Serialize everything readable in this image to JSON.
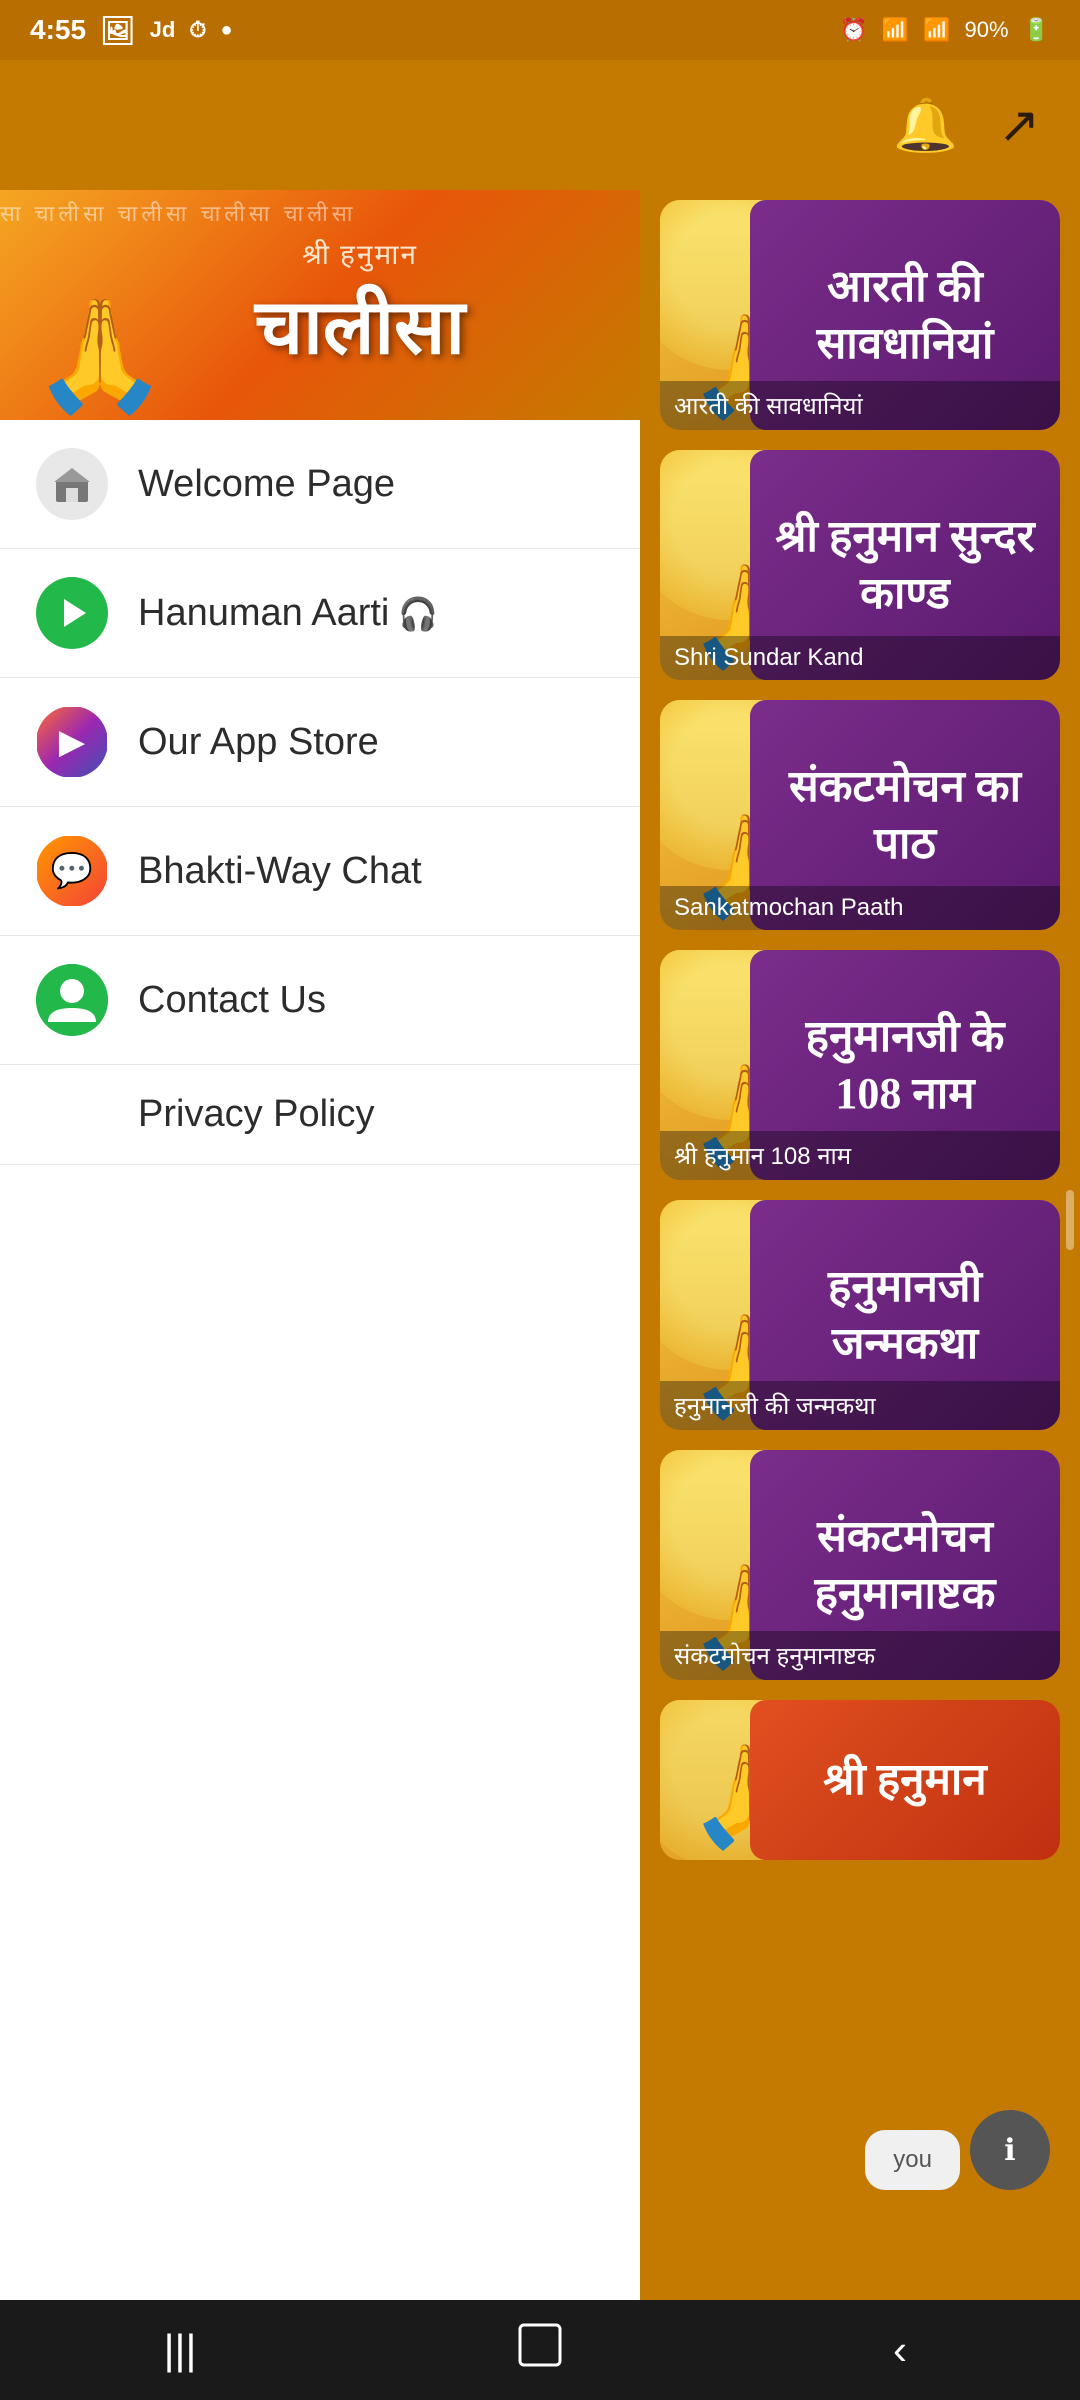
{
  "statusBar": {
    "time": "4:55",
    "carrier": "Jd",
    "batteryPercent": "90%"
  },
  "header": {
    "bell_label": "🔔",
    "share_label": "⮊"
  },
  "drawer": {
    "banner": {
      "title": "चालीसा",
      "subtitle": "श्री हनुमान",
      "repeated_text": "सा चालीसा चालीसा चालीसा चालीसा"
    },
    "menuItems": [
      {
        "id": "welcome",
        "label": "Welcome Page",
        "iconType": "home"
      },
      {
        "id": "aarti",
        "label": "Hanuman Aarti",
        "iconType": "aarti",
        "hasHeadphones": true
      },
      {
        "id": "store",
        "label": "Our App Store",
        "iconType": "store"
      },
      {
        "id": "chat",
        "label": "Bhakti-Way Chat",
        "iconType": "chat"
      },
      {
        "id": "contact",
        "label": "Contact Us",
        "iconType": "contact"
      }
    ],
    "privacyPolicy": "Privacy Policy"
  },
  "cards": [
    {
      "id": "aarti-card",
      "hindiText": "आरती की सावधानियां",
      "label": "आरती की सावधानियां",
      "colorClass": "card-purple",
      "emoji": "🙏"
    },
    {
      "id": "sundar-kand",
      "hindiText": "श्री हनुमान सुन्दर काण्ड",
      "label": "Shri Sundar Kand",
      "colorClass": "card-purple",
      "emoji": "🙏"
    },
    {
      "id": "sankat-mochan",
      "hindiText": "संकटमोचन का पाठ",
      "label": "Sankatmochan Paath",
      "colorClass": "card-purple",
      "emoji": "🙏"
    },
    {
      "id": "108-naam",
      "hindiText": "हनुमानजी के 108 नाम",
      "label": "श्री हनुमान 108 नाम",
      "colorClass": "card-purple",
      "emoji": "🙏"
    },
    {
      "id": "janmkatha",
      "hindiText": "हनुमानजी जन्मकथा",
      "label": "हनुमानजी की जन्मकथा",
      "colorClass": "card-purple",
      "emoji": "🙏"
    },
    {
      "id": "hanumanastak",
      "hindiText": "संकटमोचन हनुमानाष्टक",
      "label": "संकटमोचन हनुमानाष्टक",
      "colorClass": "card-purple",
      "emoji": "🙏"
    },
    {
      "id": "shri-hanuman",
      "hindiText": "श्री हनुमान",
      "label": "",
      "colorClass": "card-orange",
      "emoji": "🙏"
    }
  ],
  "chatBubble": {
    "text": "you"
  },
  "bottomNav": {
    "menu_icon": "|||",
    "home_icon": "□",
    "back_icon": "<"
  }
}
